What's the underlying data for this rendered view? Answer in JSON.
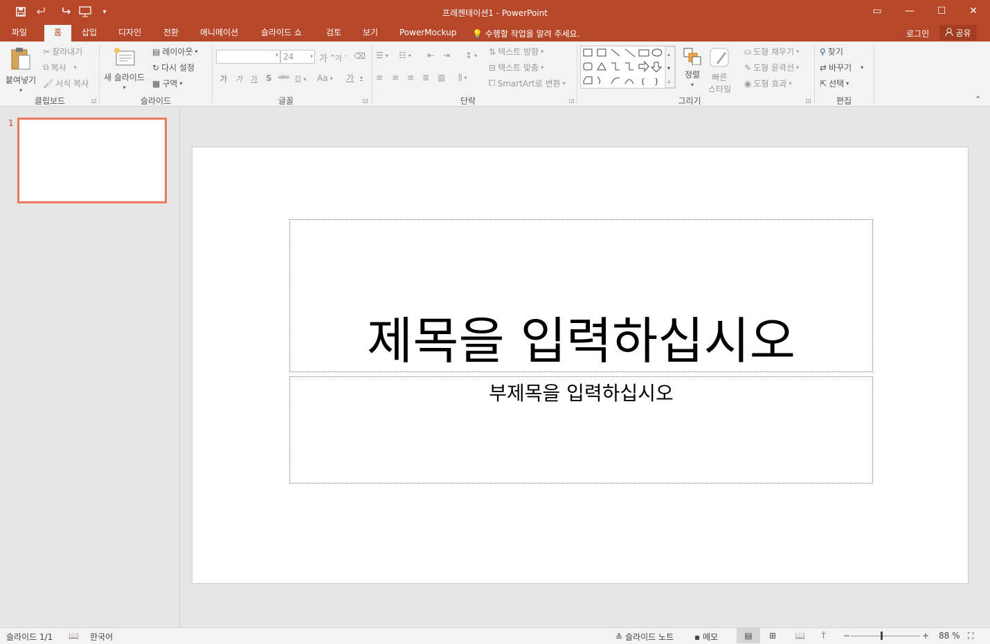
{
  "window": {
    "title": "프레젠테이션1 - PowerPoint",
    "quick_access": {
      "save_icon": "save-icon",
      "undo_icon": "undo-icon",
      "redo_icon": "redo-icon",
      "present_icon": "start-from-beginning-icon",
      "customize_icon": "customize-toolbar-icon"
    },
    "controls": {
      "ribbon_options": "▭",
      "minimize": "—",
      "maximize": "☐",
      "close": "✕"
    }
  },
  "tabs": [
    "파일",
    "홈",
    "삽입",
    "디자인",
    "전환",
    "애니메이션",
    "슬라이드 쇼",
    "검토",
    "보기",
    "PowerMockup"
  ],
  "active_tab": "홈",
  "tell_me": "수행할 작업을 알려 주세요.",
  "account": {
    "login": "로그인",
    "share": "공유"
  },
  "ribbon": {
    "clipboard": {
      "label": "클립보드",
      "paste": "붙여넣기",
      "cut": "잘라내기",
      "copy": "복사",
      "format_painter": "서식 복사"
    },
    "slides": {
      "label": "슬라이드",
      "new_slide": "새 슬라이드",
      "layout": "레이아웃",
      "reset": "다시 설정",
      "section": "구역"
    },
    "font": {
      "label": "글꼴",
      "font_name": "",
      "font_size": "24",
      "grow": "가",
      "shrink": "가",
      "bold": "가",
      "italic": "가",
      "underline": "가",
      "shadow": "S",
      "strike": "abc",
      "spacing": "갔",
      "case": "Aa",
      "color": "가"
    },
    "paragraph": {
      "label": "단락",
      "text_direction": "텍스트 방향",
      "align_text": "텍스트 맞춤",
      "smartart": "SmartArt로 변환"
    },
    "drawing": {
      "label": "그리기",
      "arrange": "정렬",
      "quick_styles_1": "빠른",
      "quick_styles_2": "스타일",
      "shape_fill": "도형 채우기",
      "shape_outline": "도형 윤곽선",
      "shape_effects": "도형 효과"
    },
    "editing": {
      "label": "편집",
      "find": "찾기",
      "replace": "바꾸기",
      "select": "선택"
    }
  },
  "thumbnails": [
    {
      "number": "1"
    }
  ],
  "slide": {
    "title_placeholder": "제목을 입력하십시오",
    "subtitle_placeholder": "부제목을 입력하십시오"
  },
  "statusbar": {
    "slide_count": "슬라이드 1/1",
    "language": "한국어",
    "notes": "슬라이드 노트",
    "comments": "메모",
    "zoom": "88 %"
  },
  "colors": {
    "accent": "#b7472a",
    "thumb_border": "#e97a5c"
  }
}
